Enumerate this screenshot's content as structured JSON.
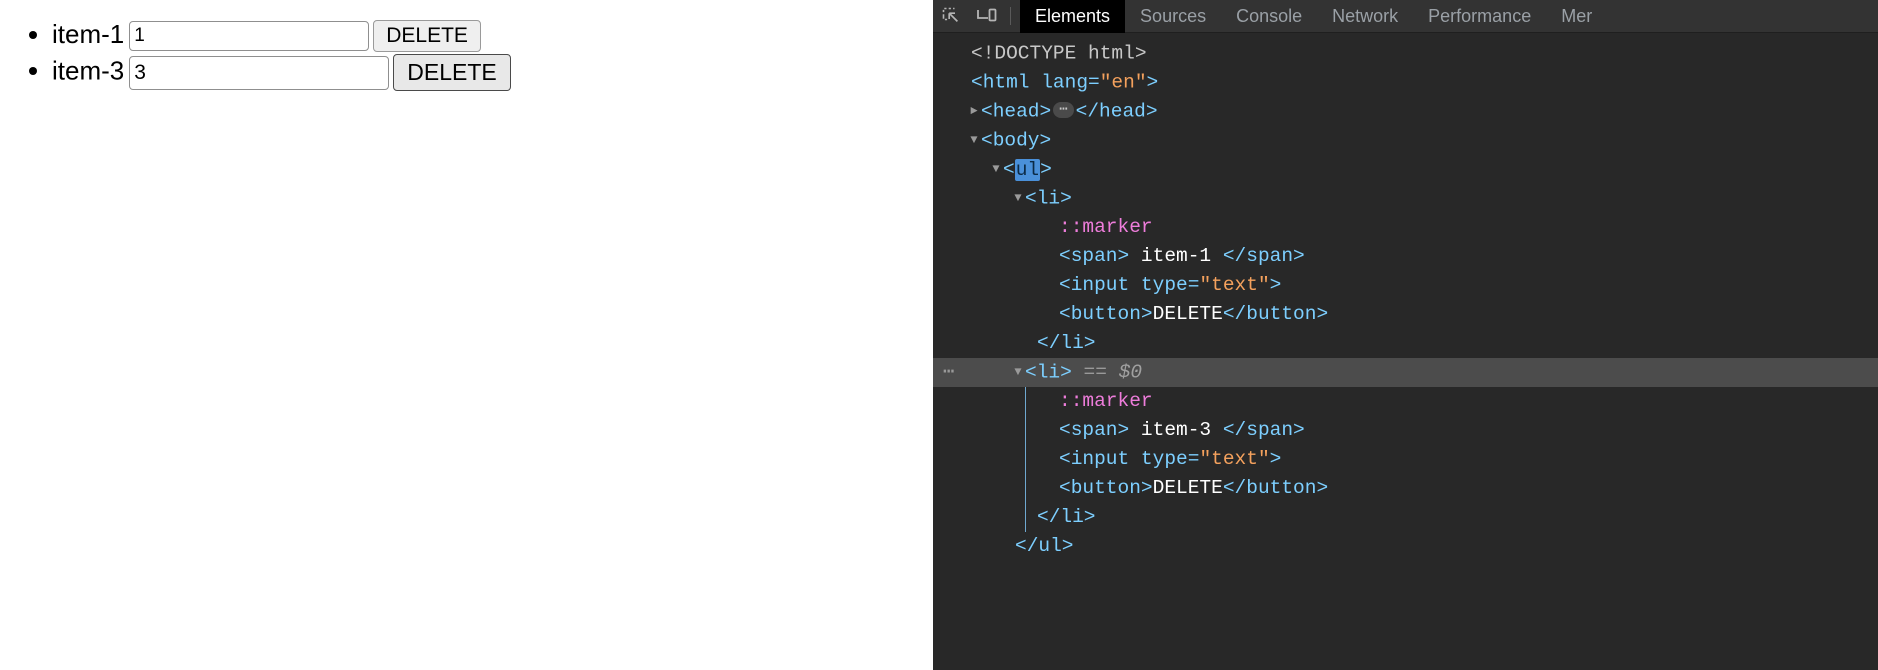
{
  "page": {
    "items": [
      {
        "label": "item-1",
        "value": "1",
        "button": "DELETE",
        "active": false
      },
      {
        "label": "item-3",
        "value": "3",
        "button": "DELETE",
        "active": true
      }
    ]
  },
  "devtools": {
    "toolbar": {
      "inspect_icon": "inspect-element-icon",
      "device_icon": "device-toolbar-icon"
    },
    "tabs": [
      {
        "label": "Elements",
        "selected": true
      },
      {
        "label": "Sources",
        "selected": false
      },
      {
        "label": "Console",
        "selected": false
      },
      {
        "label": "Network",
        "selected": false
      },
      {
        "label": "Performance",
        "selected": false
      },
      {
        "label": "Mer",
        "selected": false
      }
    ],
    "colors": {
      "panel_bg": "#282828",
      "tabbar_bg": "#333333",
      "selected_tab_bg": "#000000",
      "selected_row_bg": "#4c4c4c",
      "tag": "#7dcfff",
      "attr_name": "#a6d0ec",
      "attr_value": "#f4a15d",
      "text_node": "#ffffff",
      "pseudo_marker": "#ee7ddb",
      "highlight": "#4a90d9"
    },
    "tree": {
      "doctype": "<!DOCTYPE html>",
      "html_open_tag": "<html lang=",
      "html_lang_value": "\"en\"",
      "html_open_close": ">",
      "head_open": "<head>",
      "head_close": "</head>",
      "body_open": "<body>",
      "ul_open_lt": "<",
      "ul_open_name": "ul",
      "ul_open_gt": ">",
      "li_open": "<li>",
      "marker": "::marker",
      "span_open": "<span>",
      "span_close": "</span>",
      "input_open": "<input type=",
      "input_type_value": "\"text\"",
      "input_close_gt": ">",
      "button_open": "<button>",
      "button_text": "DELETE",
      "button_close": "</button>",
      "li_close": "</li>",
      "ul_close": "</ul>",
      "item1_text": "item-1",
      "item2_text": "item-3",
      "selected_marker_eq": "==",
      "selected_marker_var": "$0",
      "row_badge": "⋯"
    }
  }
}
